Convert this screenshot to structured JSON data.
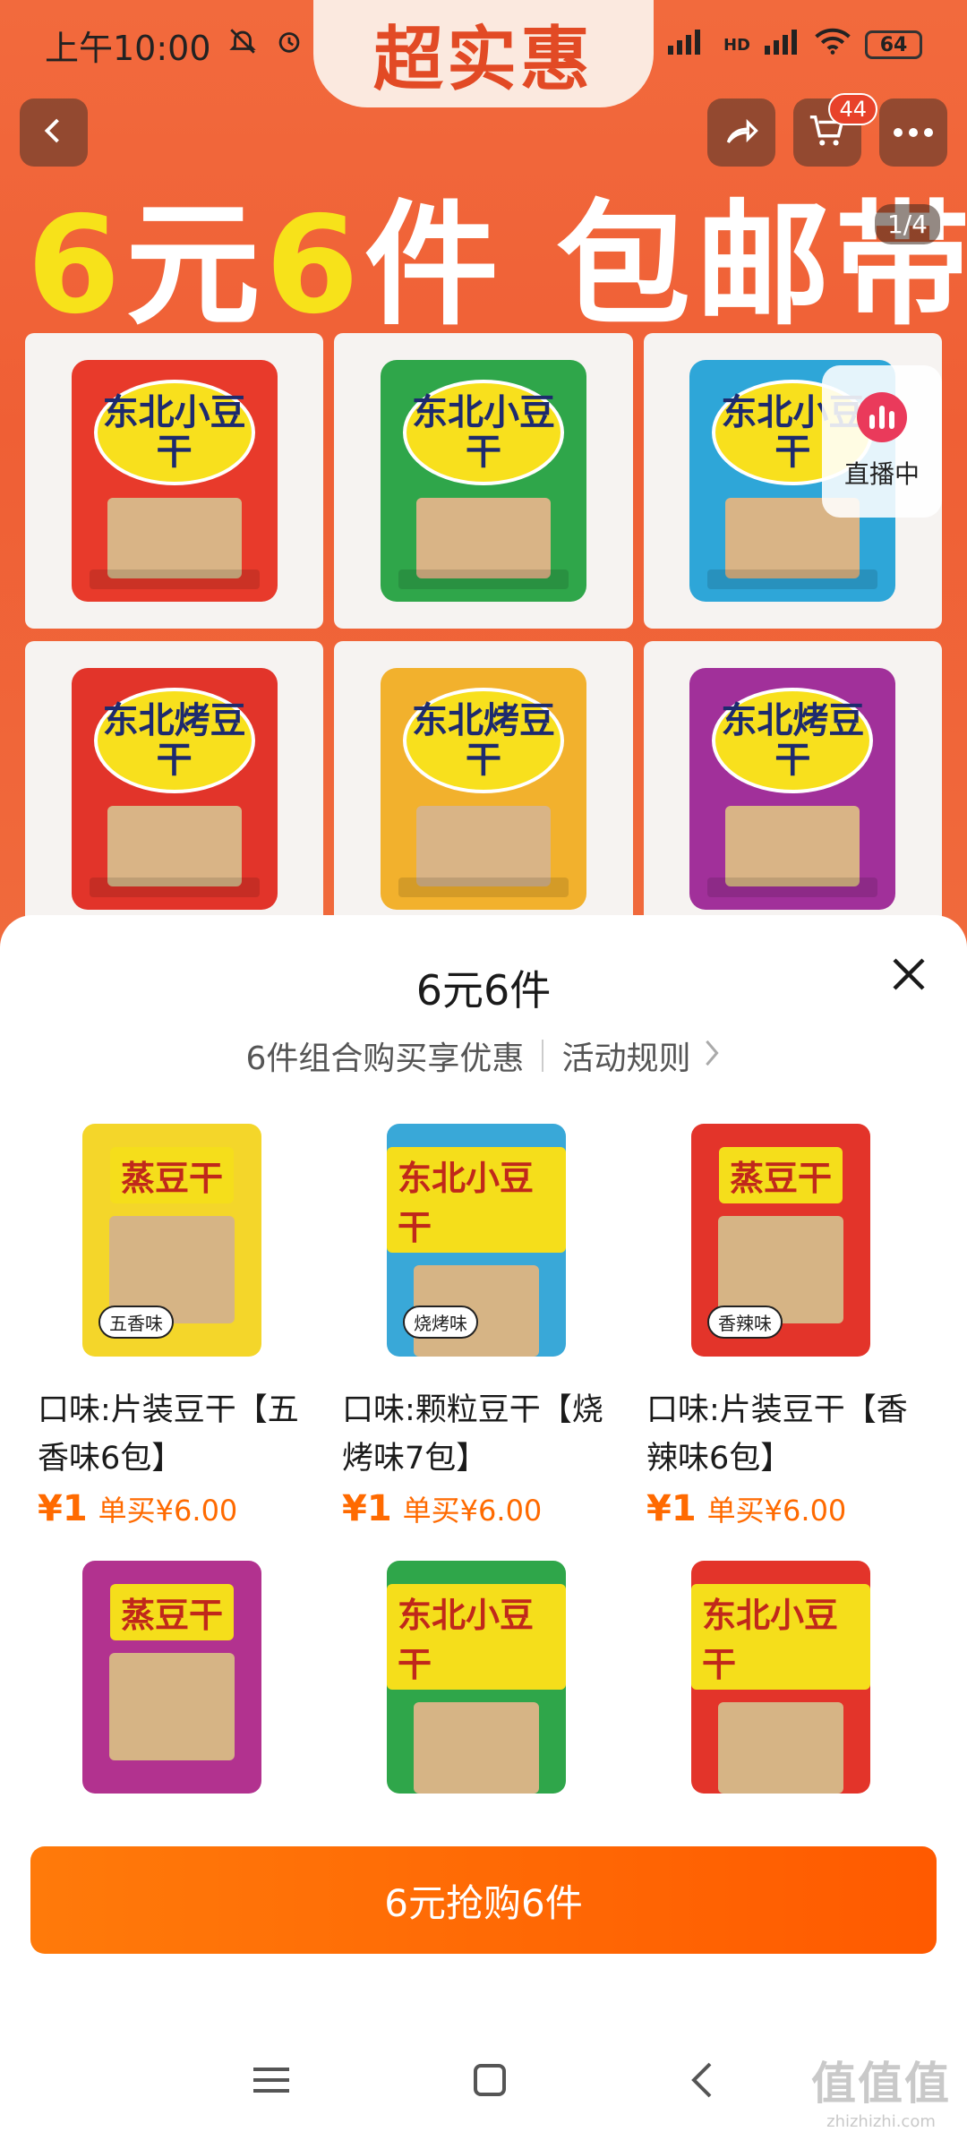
{
  "status_bar": {
    "time": "上午10:00",
    "network": "HD",
    "battery": "64"
  },
  "banner": {
    "tab_title": "超实惠",
    "slogan_yellow_1": "6",
    "slogan_white_1": "元",
    "slogan_yellow_2": "6",
    "slogan_white_2": "件 包邮带走",
    "pager": "1/4",
    "cart_badge": "44",
    "live_label": "直播中",
    "products": [
      {
        "brand": "东北小豆干",
        "color": "#e83a2b"
      },
      {
        "brand": "东北小豆干",
        "color": "#2fa64a"
      },
      {
        "brand": "东北小豆干",
        "color": "#2ea6d8"
      },
      {
        "brand": "东北烤豆干",
        "color": "#e2342a"
      },
      {
        "brand": "东北烤豆干",
        "color": "#f2b12d"
      },
      {
        "brand": "东北烤豆干",
        "color": "#a1309a"
      }
    ]
  },
  "sheet": {
    "title": "6元6件",
    "subtitle": "6件组合购买享优惠",
    "rules_link": "活动规则",
    "cta_label": "6元抢购6件",
    "items": [
      {
        "name": "口味:片装豆干【五香味6包】",
        "price": "¥1",
        "single_price": "单买¥6.00",
        "pack_label": "蒸豆干",
        "flavor_tag": "五香味",
        "bg": "#f4d62a"
      },
      {
        "name": "口味:颗粒豆干【烧烤味7包】",
        "price": "¥1",
        "single_price": "单买¥6.00",
        "pack_label": "东北小豆干",
        "flavor_tag": "烧烤味",
        "bg": "#39a8d8"
      },
      {
        "name": "口味:片装豆干【香辣味6包】",
        "price": "¥1",
        "single_price": "单买¥6.00",
        "pack_label": "蒸豆干",
        "flavor_tag": "香辣味",
        "bg": "#e3342a"
      },
      {
        "name": "",
        "price": "",
        "single_price": "",
        "pack_label": "蒸豆干",
        "flavor_tag": "",
        "bg": "#b2328f"
      },
      {
        "name": "",
        "price": "",
        "single_price": "",
        "pack_label": "东北小豆干",
        "flavor_tag": "",
        "bg": "#2fa64a"
      },
      {
        "name": "",
        "price": "",
        "single_price": "",
        "pack_label": "东北小豆干",
        "flavor_tag": "",
        "bg": "#e3342a"
      }
    ]
  },
  "watermark": {
    "main": "值值值",
    "sub": "zhizhizhi.com"
  },
  "colors": {
    "accent": "#ff6a00",
    "banner": "#f06a3c"
  }
}
